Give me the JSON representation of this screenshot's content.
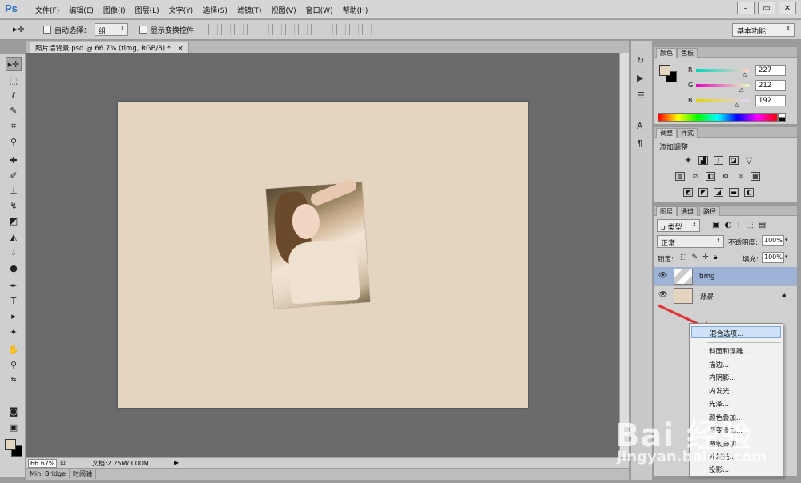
{
  "app": {
    "logo": "Ps"
  },
  "menu": [
    "文件(F)",
    "编辑(E)",
    "图像(I)",
    "图层(L)",
    "文字(Y)",
    "选择(S)",
    "滤镜(T)",
    "视图(V)",
    "窗口(W)",
    "帮助(H)"
  ],
  "window_controls": [
    "–",
    "▭",
    "✕"
  ],
  "options": {
    "auto_select_label": "自动选择：",
    "auto_select_value": "组",
    "show_transform_label": "显示变换控件",
    "workspace": "基本功能"
  },
  "document": {
    "tab_title": "照片墙背景.psd @ 66.7% (timg, RGB/8) *",
    "tab_close": "×",
    "zoom": "66.67%",
    "doc_info": "文档:2.25M/3.00M",
    "canvas_color": "#e5d4c0"
  },
  "bottom_tabs": [
    "Mini Bridge",
    "时间轴"
  ],
  "color_panel": {
    "tabs": [
      "颜色",
      "色板"
    ],
    "r_label": "R",
    "g_label": "G",
    "b_label": "B",
    "r": "227",
    "g": "212",
    "b": "192",
    "foreground": "#e3d4c0",
    "background": "#000000"
  },
  "adjust_panel": {
    "tabs": [
      "调整",
      "样式"
    ],
    "title": "添加调整"
  },
  "layers_panel": {
    "tabs": [
      "图层",
      "通道",
      "路径"
    ],
    "kind": "ρ 类型",
    "blend_mode": "正常",
    "opacity_label": "不透明度:",
    "opacity": "100%",
    "lock_label": "锁定:",
    "fill_label": "填充:",
    "fill": "100%",
    "layers": [
      {
        "name": "timg",
        "selected": true
      },
      {
        "name": "背景",
        "selected": false
      }
    ]
  },
  "context_menu": {
    "items": [
      "混合选项...",
      "斜面和浮雕...",
      "描边...",
      "内阴影...",
      "内发光...",
      "光泽...",
      "颜色叠加...",
      "渐变叠加...",
      "图案叠加...",
      "外发光...",
      "投影..."
    ]
  },
  "watermark": {
    "brand": "Bai 经验",
    "url": "jingyan.baidu.com"
  },
  "colors": {
    "selection": "#9cb2d6",
    "highlight": "#cde2f7",
    "arrow": "#e03030"
  }
}
